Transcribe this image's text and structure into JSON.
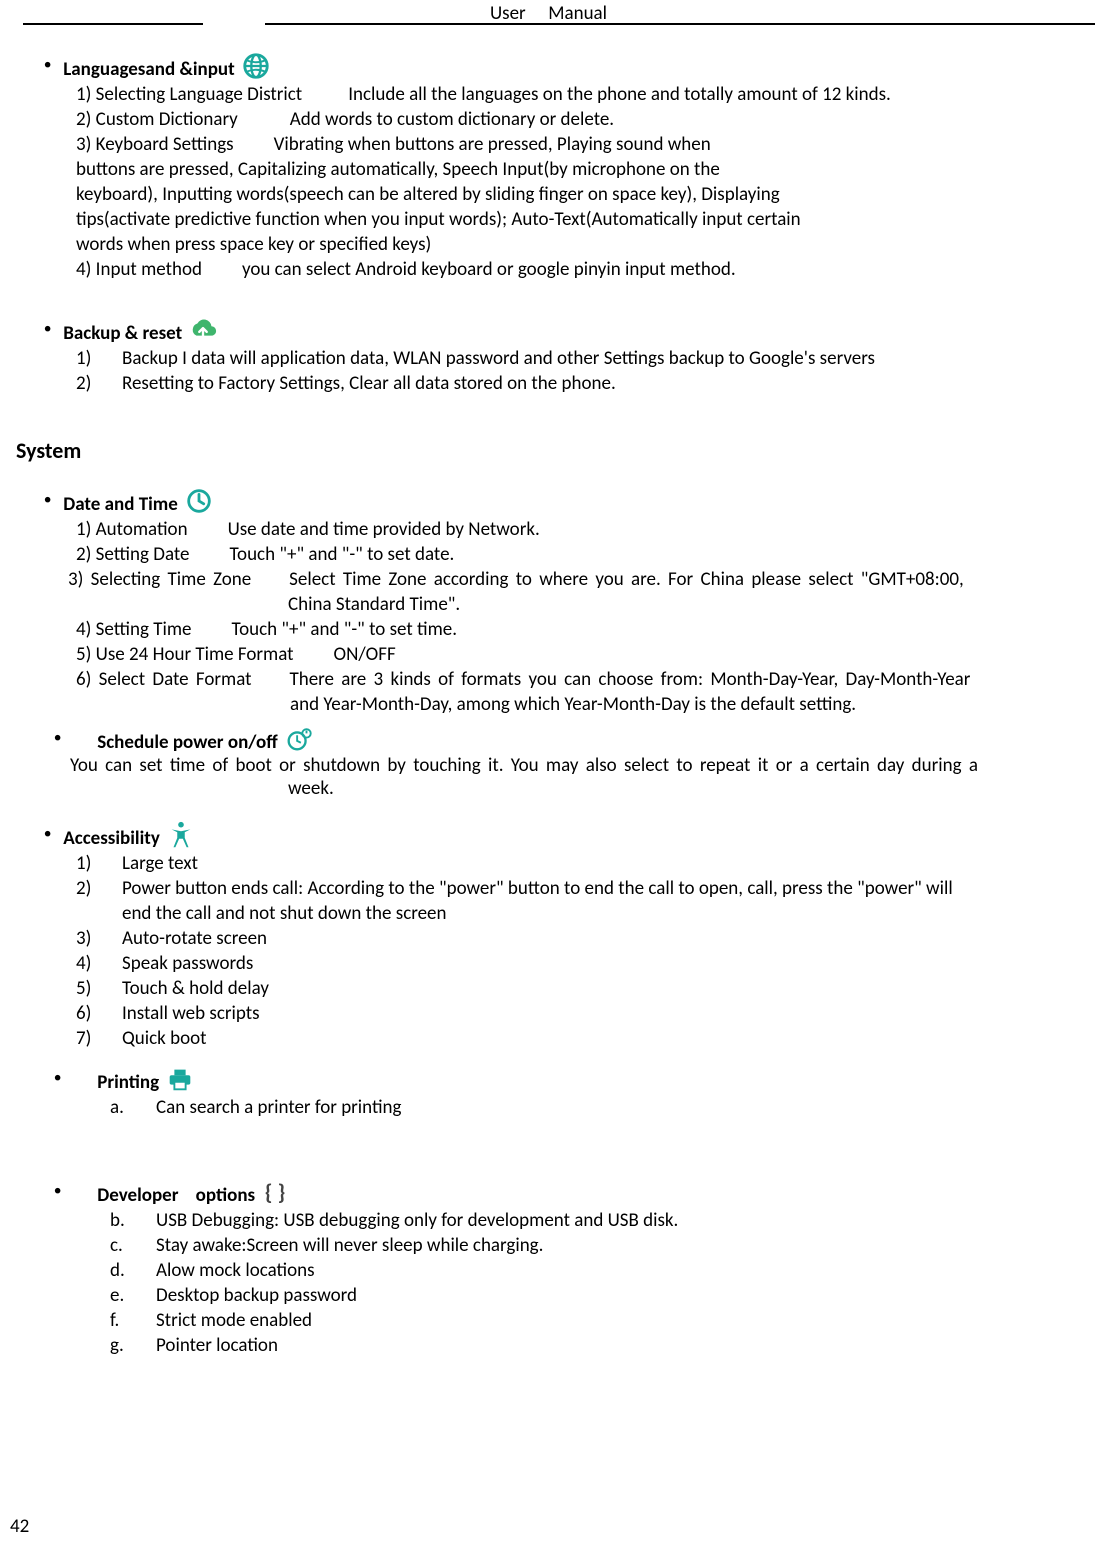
{
  "header": {
    "left": "User",
    "right": "Manual"
  },
  "page_number": "42",
  "lang": {
    "title": "Languagesand &input",
    "l1a": "1) Selecting Language District",
    "l1b": "Include all the languages on the phone and totally amount of 12 kinds.",
    "l2a": "2) Custom Dictionary",
    "l2b": "Add words to custom dictionary or delete.",
    "l3a": "3) Keyboard Settings",
    "l3b": "Vibrating when buttons are pressed, Playing sound when",
    "l3c": "buttons are pressed, Capitalizing automatically, Speech Input(by microphone on the",
    "l3d": "keyboard), Inputting words(speech can be altered by sliding finger on space key), Displaying",
    "l3e": "tips(activate predictive function when you input words); Auto-Text(Automatically input certain",
    "l3f": "words when press space key or specified keys)",
    "l4a": "4) Input method",
    "l4b": "you can select Android keyboard or google pinyin input method."
  },
  "backup": {
    "title": "Backup & reset",
    "i1_n": "1)",
    "i1": "Backup I data will application data, WLAN password and other Settings backup to Google's servers",
    "i2_n": "2)",
    "i2": "Resetting to Factory Settings, Clear all data stored on the phone."
  },
  "system_heading": "System",
  "dt": {
    "title": "Date and Time",
    "l1a": "1) Automation",
    "l1b": "Use date and time provided by Network.",
    "l2a": "2) Setting Date",
    "l2b": "Touch \"+\" and \"-\" to set date.",
    "l3a": "3) Selecting Time Zone",
    "l3b": "Select Time Zone according to where you are. For China please select \"GMT+08:00,",
    "l3c": "China Standard Time\".",
    "l4a": "4) Setting Time",
    "l4b": "Touch \"+\" and \"-\" to set time.",
    "l5a": "5) Use 24 Hour Time Format",
    "l5b": "ON/OFF",
    "l6a": "6) Select Date Format",
    "l6b": "There are 3 kinds of formats you can choose from: Month-Day-Year, Day-Month-Year",
    "l6c": "and Year-Month-Day, among which Year-Month-Day is the default setting."
  },
  "sched": {
    "title": "Schedule power on/off",
    "body1": "You can set time of boot or shutdown by touching it. You may also select to repeat it or a certain day during a",
    "body2": "week."
  },
  "acc": {
    "title": "Accessibility",
    "i1_n": "1)",
    "i1": "Large text",
    "i2_n": "2)",
    "i2a": "Power button ends call: ",
    "i2b": "According to the \"power\" button to end the call to open, call, press the \"power\" will",
    "i2c": "end the call and not shut down the screen",
    "i3_n": "3)",
    "i3": "Auto-rotate screen",
    "i4_n": "4)",
    "i4": "Speak passwords",
    "i5_n": "5)",
    "i5": "Touch & hold delay",
    "i6_n": "6)",
    "i6": "Install web scripts",
    "i7_n": "7)",
    "i7": "Quick boot"
  },
  "print": {
    "title": "Printing",
    "i1_n": "a.",
    "i1": "Can search a printer for printing"
  },
  "dev": {
    "title": "Developer    options",
    "ib_n": "b.",
    "ib_a": "USB Debugging: U",
    "ib_b": "SB debugging only for development and USB disk.",
    "ic_n": "c.",
    "ic": "Stay awake:Screen will never sleep while charging.",
    "id_n": "d.",
    "id": "Alow mock locations",
    "ie_n": "e.",
    "ie": "Desktop backup password",
    "if_n": "f.",
    "if": "Strict mode enabled",
    "ig_n": "g.",
    "ig": "Pointer location"
  }
}
